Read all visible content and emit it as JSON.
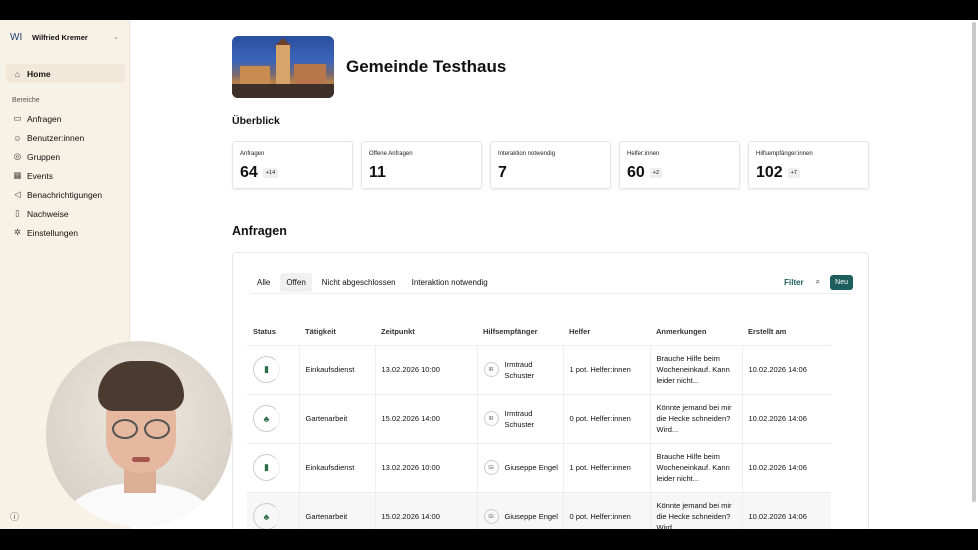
{
  "user": {
    "initials": "WI",
    "name": "Wilfried Kremer"
  },
  "sidebar": {
    "home": "Home",
    "section": "Bereiche",
    "items": [
      {
        "label": "Anfragen",
        "icon": "inbox-icon"
      },
      {
        "label": "Benutzer:innen",
        "icon": "users-icon"
      },
      {
        "label": "Gruppen",
        "icon": "group-icon"
      },
      {
        "label": "Events",
        "icon": "calendar-icon"
      },
      {
        "label": "Benachrichtigungen",
        "icon": "megaphone-icon"
      },
      {
        "label": "Nachweise",
        "icon": "bookmark-icon"
      },
      {
        "label": "Einstellungen",
        "icon": "gear-icon"
      }
    ]
  },
  "page": {
    "title": "Gemeinde Testhaus"
  },
  "overview": {
    "heading": "Überblick",
    "stats": [
      {
        "label": "Anfragen",
        "value": "64",
        "delta": "+14"
      },
      {
        "label": "Offene Anfragen",
        "value": "11",
        "delta": ""
      },
      {
        "label": "Interaktion notwendig",
        "value": "7",
        "delta": ""
      },
      {
        "label": "Helfer:innen",
        "value": "60",
        "delta": "+2"
      },
      {
        "label": "Hilfsempfänger:innen",
        "value": "102",
        "delta": "+7"
      }
    ]
  },
  "requests": {
    "heading": "Anfragen",
    "tabs": [
      "Alle",
      "Offen",
      "Nicht abgeschlossen",
      "Interaktion notwendig"
    ],
    "active_tab": "Offen",
    "filter_label": "Filter",
    "new_label": "Neu",
    "columns": [
      "Status",
      "Tätigkeit",
      "Zeitpunkt",
      "Hilfsempfänger",
      "Helfer",
      "Anmerkungen",
      "Erstellt am"
    ],
    "rows": [
      {
        "activity": "Einkaufsdienst",
        "time": "13.02.2026 10:00",
        "initials": "IR",
        "recipient": "Irmtraud Schuster",
        "helper": "1 pot. Helfer:innen",
        "note": "Brauche Hilfe beim Wocheneinkauf. Kann leider nicht...",
        "created": "10.02.2026 14:06"
      },
      {
        "activity": "Gartenarbeit",
        "time": "15.02.2026 14:00",
        "initials": "IR",
        "recipient": "Irmtraud Schuster",
        "helper": "0 pot. Helfer:innen",
        "note": "Könnte jemand bei mir die Hecke schneiden? Wird...",
        "created": "10.02.2026 14:06"
      },
      {
        "activity": "Einkaufsdienst",
        "time": "13.02.2026 10:00",
        "initials": "GI",
        "recipient": "Giuseppe Engel",
        "helper": "1 pot. Helfer:innen",
        "note": "Brauche Hilfe beim Wocheneinkauf. Kann leider nicht...",
        "created": "10.02.2026 14:06"
      },
      {
        "activity": "Gartenarbeit",
        "time": "15.02.2026 14:00",
        "initials": "GI",
        "recipient": "Giuseppe Engel",
        "helper": "0 pot. Helfer:innen",
        "note": "Könnte jemand bei mir die Hecke schneiden? Wird...",
        "created": "10.02.2026 14:06"
      }
    ]
  }
}
